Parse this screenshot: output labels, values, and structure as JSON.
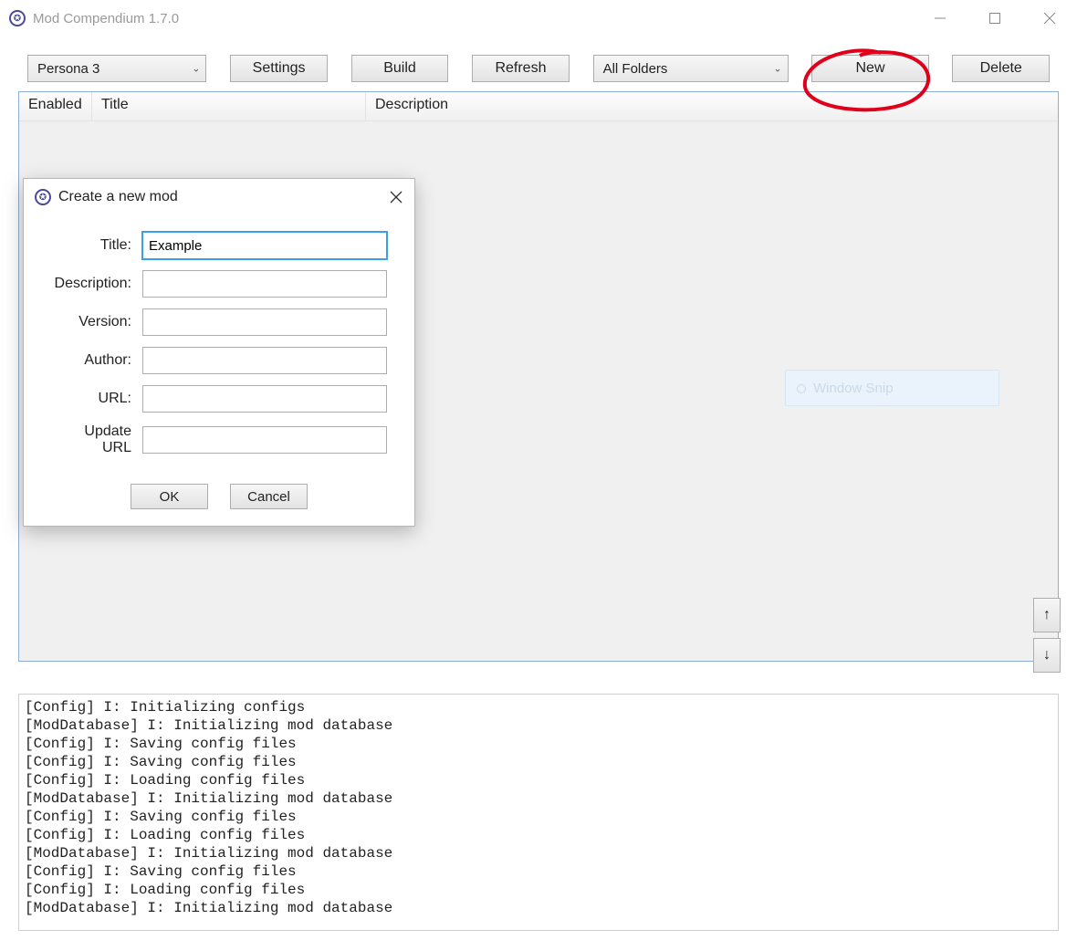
{
  "window": {
    "title": "Mod Compendium 1.7.0"
  },
  "toolbar": {
    "game_select": "Persona 3",
    "settings": "Settings",
    "build": "Build",
    "refresh": "Refresh",
    "folders_select": "All Folders",
    "new": "New",
    "delete": "Delete"
  },
  "grid": {
    "col_enabled": "Enabled",
    "col_title": "Title",
    "col_description": "Description"
  },
  "side": {
    "up": "↑",
    "down": "↓"
  },
  "snip": {
    "label": "Window Snip"
  },
  "dialog": {
    "title": "Create a new mod",
    "fields": {
      "title_label": "Title:",
      "title_value": "Example",
      "description_label": "Description:",
      "description_value": "",
      "version_label": "Version:",
      "version_value": "",
      "author_label": "Author:",
      "author_value": "",
      "url_label": "URL:",
      "url_value": "",
      "update_url_label": "Update URL",
      "update_url_value": ""
    },
    "ok": "OK",
    "cancel": "Cancel"
  },
  "log": "[Config] I: Initializing configs\n[ModDatabase] I: Initializing mod database\n[Config] I: Saving config files\n[Config] I: Saving config files\n[Config] I: Loading config files\n[ModDatabase] I: Initializing mod database\n[Config] I: Saving config files\n[Config] I: Loading config files\n[ModDatabase] I: Initializing mod database\n[Config] I: Saving config files\n[Config] I: Loading config files\n[ModDatabase] I: Initializing mod database"
}
